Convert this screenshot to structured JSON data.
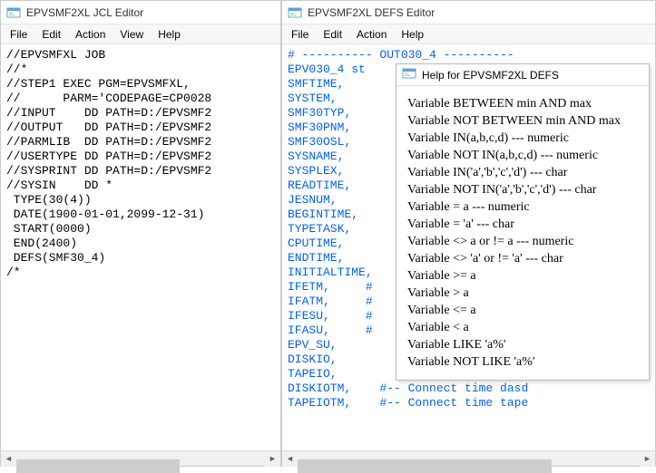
{
  "window1": {
    "title": "EPVSMF2XL JCL Editor",
    "menus": [
      "File",
      "Edit",
      "Action",
      "View",
      "Help"
    ],
    "text": "//EPVSMFXL JOB\n//*\n//STEP1 EXEC PGM=EPVSMFXL,\n//      PARM='CODEPAGE=CP0028\n//INPUT    DD PATH=D:/EPVSMF2\n//OUTPUT   DD PATH=D:/EPVSMF2\n//PARMLIB  DD PATH=D:/EPVSMF2\n//USERTYPE DD PATH=D:/EPVSMF2\n//SYSPRINT DD PATH=D:/EPVSMF2\n//SYSIN    DD *\n TYPE(30(4))\n DATE(1900-01-01,2099-12-31)\n START(0000)\n END(2400)\n DEFS(SMF30_4)\n/*"
  },
  "window2": {
    "title": "EPVSMF2XL DEFS Editor",
    "menus": [
      "File",
      "Edit",
      "Action",
      "Help"
    ],
    "text": "# ---------- OUT030_4 ----------\nEPV030_4 st\nSMFTIME,\nSYSTEM,\nSMF30TYP,\nSMF30PNM,\nSMF30OSL,\nSYSNAME,\nSYSPLEX,\nREADTIME,\nJESNUM,\nBEGINTIME,\nTYPETASK,\nCPUTIME,\nENDTIME,\nINITIALTIME,\nIFETM,     #\nIFATM,     #\nIFESU,     #\nIFASU,     #\nEPV_SU,\nDISKIO,\nTAPEIO,\nDISKIOTM,    #-- Connect time dasd\nTAPEIOTM,    #-- Connect time tape"
  },
  "help": {
    "title": "Help for EPVSMF2XL DEFS",
    "lines": [
      "Variable BETWEEN min AND max",
      "Variable NOT BETWEEN min AND max",
      "Variable IN(a,b,c,d) --- numeric",
      "Variable NOT IN(a,b,c,d) --- numeric",
      "Variable IN('a','b','c','d') --- char",
      "Variable NOT IN('a','b','c','d') --- char",
      "Variable = a --- numeric",
      "Variable = 'a' --- char",
      "Variable <> a or != a --- numeric",
      "Variable <> 'a' or != 'a' --- char",
      "Variable >= a",
      "Variable > a",
      "Variable <= a",
      "Variable < a",
      "Variable LIKE 'a%'",
      "Variable NOT LIKE 'a%'"
    ]
  }
}
